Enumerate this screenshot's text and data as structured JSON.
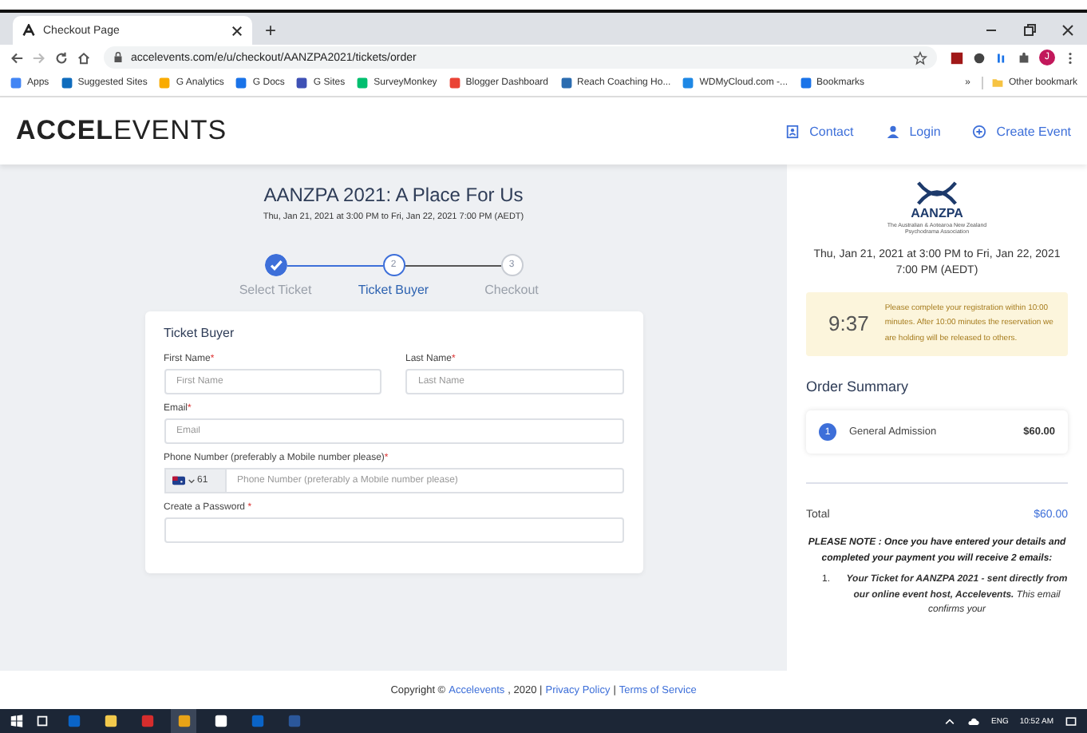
{
  "browser": {
    "tab_title": "Checkout Page",
    "new_tab": "+",
    "url": "accelevents.com/e/u/checkout/AANZPA2021/tickets/order",
    "profile_initial": "J",
    "bookmarks": [
      {
        "label": "Apps",
        "color": "#4285f4"
      },
      {
        "label": "Suggested Sites",
        "color": "#0f6cbd"
      },
      {
        "label": "G Analytics",
        "color": "#f9ab00"
      },
      {
        "label": "G Docs",
        "color": "#1a73e8"
      },
      {
        "label": "G Sites",
        "color": "#3f51b5"
      },
      {
        "label": "SurveyMonkey",
        "color": "#00bf6f"
      },
      {
        "label": "Blogger Dashboard",
        "color": "#ea4335"
      },
      {
        "label": "Reach Coaching Ho...",
        "color": "#2b6cb0"
      },
      {
        "label": "WDMyCloud.com -...",
        "color": "#1e88e5"
      },
      {
        "label": "Bookmarks",
        "color": "#1a73e8"
      }
    ],
    "overflow": "»",
    "other_bookmarks": "Other bookmark"
  },
  "header": {
    "logo": "**ACCEL**EVENTS",
    "nav": [
      {
        "label": "Contact",
        "kind": "contact"
      },
      {
        "label": "Login",
        "kind": "user"
      },
      {
        "label": "Create Event",
        "kind": "plus"
      }
    ]
  },
  "event": {
    "title": "AANZPA 2021: A Place For Us",
    "dates": "Thu, Jan 21, 2021 at 3:00 PM to Fri, Jan 22, 2021 7:00 PM (AEDT)"
  },
  "steps": [
    {
      "label": "Select Ticket",
      "completed": true,
      "selected": false
    },
    {
      "number": "2",
      "label": "Ticket Buyer",
      "completed": false,
      "selected": true
    },
    {
      "number": "3",
      "label": "Checkout",
      "completed": false,
      "selected": false
    }
  ],
  "form": {
    "title": "Ticket Buyer",
    "rows": [
      [
        {
          "kind": "text",
          "label": "First Name",
          "mark": "*",
          "placeholder": "First Name"
        },
        {
          "kind": "text",
          "label": "Last Name",
          "mark": "*",
          "placeholder": "Last Name"
        }
      ],
      [
        {
          "kind": "text",
          "label": "Email",
          "mark": "*",
          "placeholder": "Email"
        }
      ],
      [
        {
          "kind": "phone",
          "label": "Phone Number (preferably a Mobile number please)",
          "mark": "*",
          "country_code": "61",
          "placeholder": "Phone Number (preferably a Mobile number please)"
        }
      ],
      [
        {
          "kind": "password",
          "label": "Create a Password ",
          "mark": "*"
        }
      ]
    ]
  },
  "footer": [
    {
      "kind": "plain",
      "text": "Copyright ©"
    },
    {
      "kind": "link",
      "text": "Accelevents"
    },
    {
      "kind": "plain",
      "text": ", 2020 |"
    },
    {
      "kind": "link",
      "text": "Privacy Policy"
    },
    {
      "kind": "plain",
      "text": "|"
    },
    {
      "kind": "link",
      "text": "Terms of Service"
    }
  ],
  "sidebar": {
    "org_name": "AANZPA",
    "org_subtitle": "The Australian & Aotearoa New Zealand Psychodrama Association",
    "dates": "Thu, Jan 21, 2021 at 3:00 PM to Fri, Jan 22, 2021 7:00 PM (AEDT)",
    "timer": "9:37",
    "timer_message": "Please complete your registration within 10:00 minutes. After 10:00 minutes the reservation we are holding will be released to others.",
    "order_title": "Order Summary",
    "items": [
      {
        "quantity": "1",
        "name": "General Admission",
        "price": "$60.00"
      }
    ],
    "total_label": "Total",
    "total": "$60.00",
    "note": "PLEASE NOTE : Once you have entered your details and completed your payment  you will receive 2 emails:",
    "list": [
      {
        "marker": "1.",
        "text": "**Your Ticket for AANZPA 2021 - sent directly from our online event host, Accelevents.** This email confirms your"
      }
    ]
  },
  "taskbar": {
    "apps": [
      {
        "color": "#0a64c8",
        "selected": false
      },
      {
        "color": "#f2c94c",
        "selected": false
      },
      {
        "color": "#d62d2d",
        "selected": false
      },
      {
        "color": "#e8a317",
        "selected": true
      },
      {
        "color": "#ffffff",
        "selected": false
      },
      {
        "color": "#0a64c8",
        "selected": false
      },
      {
        "color": "#2b579a",
        "selected": false
      }
    ],
    "language": "ENG",
    "time": "10:52 AM"
  }
}
